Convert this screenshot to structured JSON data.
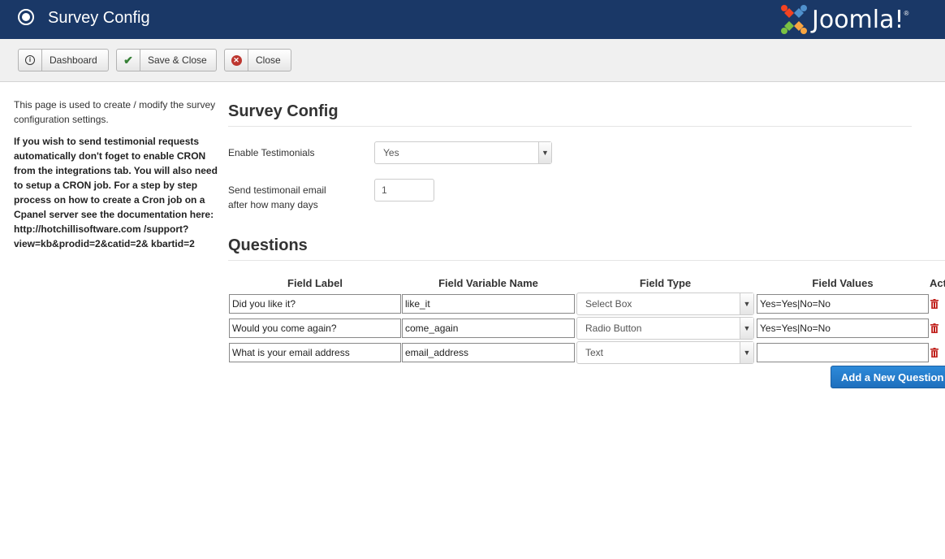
{
  "header": {
    "title": "Survey Config",
    "logo_text": "Joomla!",
    "logo_reg": "®"
  },
  "toolbar": {
    "dashboard_label": "Dashboard",
    "save_close_label": "Save & Close",
    "close_label": "Close"
  },
  "sidebar": {
    "intro": "This page is used to create / modify the survey configuration settings.",
    "note": "If you wish to send testimonial requests automatically don't foget to enable CRON from the integrations tab. You will also need to setup a CRON job. For a step by step process on how to create a Cron job on a Cpanel server see the documentation here: http://hotchillisoftware.com /support?view=kb&prodid=2&catid=2& kbartid=2"
  },
  "config": {
    "section_title": "Survey Config",
    "enable_label": "Enable Testimonials",
    "enable_value": "Yes",
    "days_label_line1": "Send testimonail email",
    "days_label_line2": "after how many days",
    "days_value": "1"
  },
  "questions": {
    "section_title": "Questions",
    "columns": [
      "Field Label",
      "Field Variable Name",
      "Field Type",
      "Field Values",
      "Act"
    ],
    "rows": [
      {
        "label": "Did you like it?",
        "variable": "like_it",
        "type": "Select Box",
        "values": "Yes=Yes|No=No"
      },
      {
        "label": "Would you come again?",
        "variable": "come_again",
        "type": "Radio Button",
        "values": "Yes=Yes|No=No"
      },
      {
        "label": "What is your email address",
        "variable": "email_address",
        "type": "Text",
        "values": ""
      }
    ],
    "add_button": "Add a New Question"
  },
  "colors": {
    "header_bg": "#1a3867",
    "primary_button": "#2384d3",
    "delete_icon": "#c0201b"
  }
}
